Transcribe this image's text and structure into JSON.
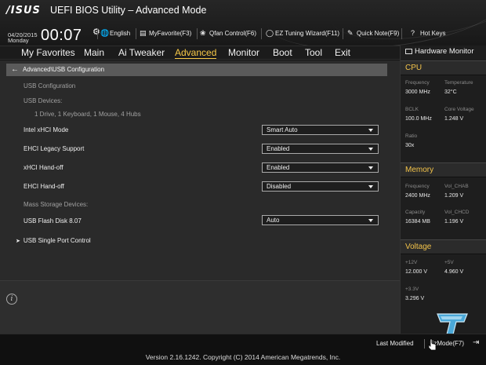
{
  "header": {
    "logo": "/ISUS",
    "title": "UEFI BIOS Utility – Advanced Mode",
    "date": "04/20/2015",
    "day": "Monday",
    "time": "00:07",
    "tools": {
      "language": "English",
      "myfavorite": "MyFavorite(F3)",
      "qfan": "Qfan Control(F6)",
      "ez_tuning": "EZ Tuning Wizard(F11)",
      "quick_note": "Quick Note(F9)",
      "hot_keys": "Hot Keys"
    }
  },
  "menu": {
    "items": [
      "My Favorites",
      "Main",
      "Ai Tweaker",
      "Advanced",
      "Monitor",
      "Boot",
      "Tool",
      "Exit"
    ],
    "active": "Advanced"
  },
  "content": {
    "breadcrumb": "Advanced\\USB Configuration",
    "section_title": "USB Configuration",
    "usb_devices_label": "USB Devices:",
    "usb_devices_value": "1 Drive, 1 Keyboard, 1 Mouse, 4 Hubs",
    "settings": [
      {
        "label": "Intel xHCI Mode",
        "value": "Smart Auto"
      },
      {
        "label": "EHCI Legacy Support",
        "value": "Enabled"
      },
      {
        "label": "xHCI Hand-off",
        "value": "Enabled"
      },
      {
        "label": "EHCI Hand-off",
        "value": "Disabled"
      }
    ],
    "mass_storage_label": "Mass Storage Devices:",
    "flash_disk": {
      "label": "USB Flash Disk 8.07",
      "value": "Auto"
    },
    "submenu": "USB Single Port Control"
  },
  "hw_monitor": {
    "title": "Hardware Monitor",
    "cpu": {
      "title": "CPU",
      "frequency_label": "Frequency",
      "frequency": "3000 MHz",
      "temperature_label": "Temperature",
      "temperature": "32°C",
      "bclk_label": "BCLK",
      "bclk": "100.0 MHz",
      "core_voltage_label": "Core Voltage",
      "core_voltage": "1.248 V",
      "ratio_label": "Ratio",
      "ratio": "30x"
    },
    "memory": {
      "title": "Memory",
      "frequency_label": "Frequency",
      "frequency": "2400 MHz",
      "vol_chab_label": "Vol_CHAB",
      "vol_chab": "1.209 V",
      "capacity_label": "Capacity",
      "capacity": "16384 MB",
      "vol_chcd_label": "Vol_CHCD",
      "vol_chcd": "1.196 V"
    },
    "voltage": {
      "title": "Voltage",
      "v12_label": "+12V",
      "v12": "12.000 V",
      "v5_label": "+5V",
      "v5": "4.960 V",
      "v33_label": "+3.3V",
      "v33": "3.296 V"
    }
  },
  "footer": {
    "last_modified": "Last Modified",
    "ez_mode": "EzMode(F7)",
    "version": "Version 2.16.1242. Copyright (C) 2014 American Megatrends, Inc."
  },
  "colors": {
    "accent": "#f7c846",
    "section_title": "#f3c34a",
    "breadcrumb_bg": "#5a5a5a"
  }
}
